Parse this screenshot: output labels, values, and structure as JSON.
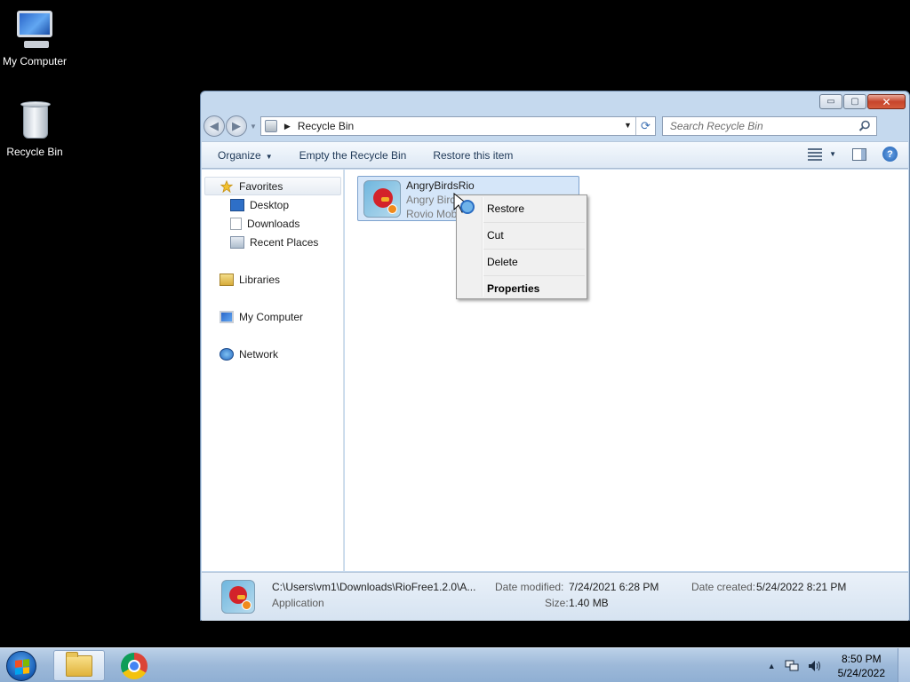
{
  "desktop": {
    "icons": [
      {
        "label": "My Computer"
      },
      {
        "label": "Recycle Bin"
      }
    ]
  },
  "window": {
    "controls": {
      "minimize": "▭",
      "maximize": "▢",
      "close": "✕"
    },
    "address": {
      "location": "Recycle Bin"
    },
    "search": {
      "placeholder": "Search Recycle Bin"
    },
    "toolbar": {
      "organize": "Organize",
      "empty_bin": "Empty the Recycle Bin",
      "restore_item": "Restore this item"
    },
    "nav_pane": {
      "favorites": "Favorites",
      "desktop": "Desktop",
      "downloads": "Downloads",
      "recent_places": "Recent Places",
      "libraries": "Libraries",
      "my_computer": "My Computer",
      "network": "Network"
    },
    "file": {
      "name": "AngryBirdsRio",
      "line2": "Angry Bird",
      "line3": "Rovio Mob"
    },
    "context_menu": {
      "items": [
        "Restore",
        "Cut",
        "Delete",
        "Properties"
      ]
    },
    "details": {
      "path": "C:\\Users\\vm1\\Downloads\\RioFree1.2.0\\A...",
      "type": "Application",
      "date_modified_label": "Date modified:",
      "date_modified": "7/24/2021 6:28 PM",
      "size_label": "Size:",
      "size": "1.40 MB",
      "date_created_label": "Date created:",
      "date_created": "5/24/2022 8:21 PM"
    }
  },
  "taskbar": {
    "clock": {
      "time": "8:50 PM",
      "date": "5/24/2022"
    },
    "tray": {
      "show_hidden": "▲"
    }
  },
  "colors": {
    "selection": "#d5e6f9",
    "window_frame": "#c5d9ee",
    "taskbar": "#9db9d9"
  }
}
